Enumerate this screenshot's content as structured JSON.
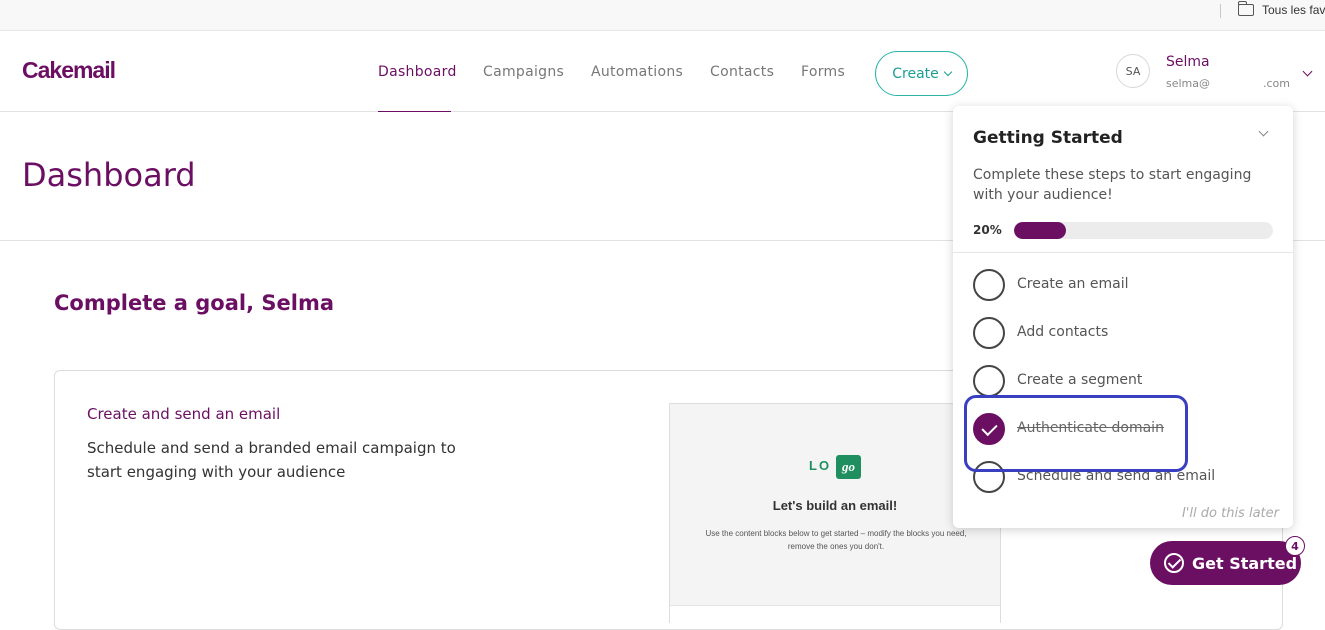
{
  "bookmarks": {
    "folder_label": "Tous les favoris"
  },
  "header": {
    "logo": "Cakemail",
    "nav": [
      "Dashboard",
      "Campaigns",
      "Automations",
      "Contacts",
      "Forms"
    ],
    "create_label": "Create",
    "user": {
      "initials": "SA",
      "name": "Selma",
      "email_start": "selma@",
      "email_end": ".com"
    }
  },
  "page": {
    "title": "Dashboard"
  },
  "goal": {
    "title": "Complete a goal, Selma",
    "card_title": "Create and send an email",
    "card_desc": "Schedule and send a branded email campaign to start engaging with your audience",
    "preview": {
      "logo_lo": "LO",
      "logo_go": "go",
      "heading": "Let's build an email!",
      "sub": "Use the content blocks below to get started – modify the blocks you need, remove the ones you don't."
    }
  },
  "getting_started": {
    "title": "Getting Started",
    "desc": "Complete these steps to start engaging with your audience!",
    "progress_label": "20%",
    "progress": 0.2,
    "steps": [
      {
        "label": "Create an email",
        "done": false
      },
      {
        "label": "Add contacts",
        "done": false
      },
      {
        "label": "Create a segment",
        "done": false
      },
      {
        "label": "Authenticate domain",
        "done": true
      },
      {
        "label": "Schedule and send an email",
        "done": false
      }
    ],
    "later": "I'll do this later",
    "button_label": "Get Started",
    "badge": "4"
  },
  "colors": {
    "brand": "#6b0f63",
    "accent": "#2bb3a8",
    "highlight": "#3a3fc0"
  },
  "icons": [
    "folder-icon",
    "chevron-down-icon",
    "check-icon",
    "check-circle-icon"
  ]
}
